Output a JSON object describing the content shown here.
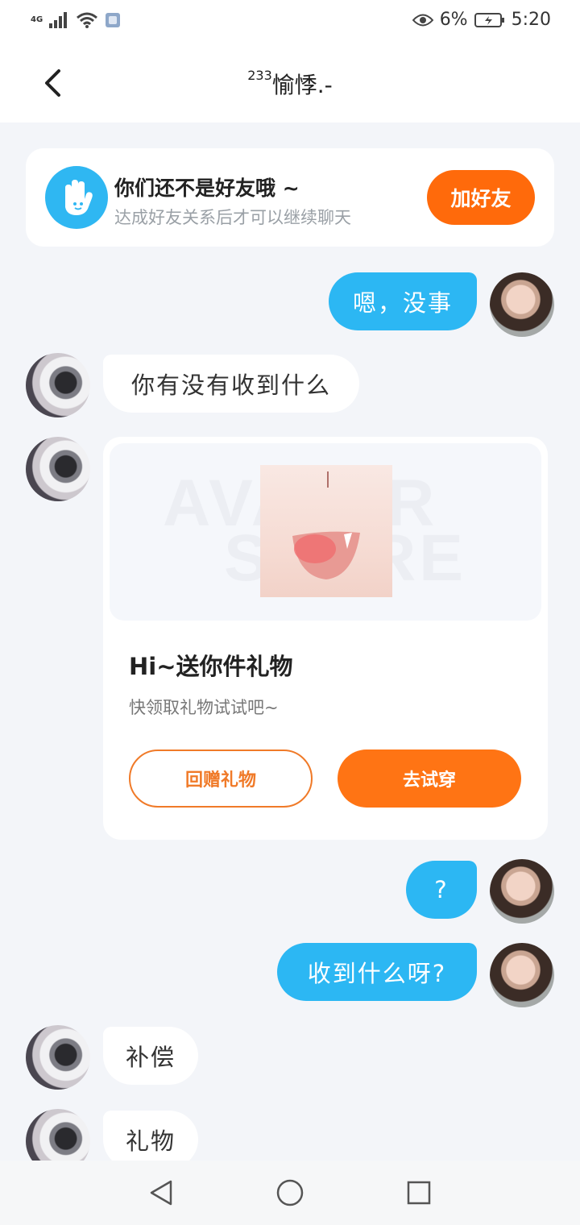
{
  "status_bar": {
    "network": "4G",
    "battery_percent": "6%",
    "time": "5:20",
    "icons": [
      "signal-icon",
      "wifi-icon",
      "app-notification-icon",
      "eye-icon",
      "battery-charging-icon"
    ]
  },
  "header": {
    "title_sup": "233",
    "title": "愉悸.-"
  },
  "friend_notice": {
    "title": "你们还不是好友哦 ~",
    "subtitle": "达成好友关系后才可以继续聊天",
    "button": "加好友",
    "icon": "hand-wave-icon"
  },
  "messages": {
    "m1": "嗯，没事",
    "m2": "你有没有收到什么",
    "m4": "?",
    "m5": "收到什么呀?",
    "m6": "补偿",
    "m7": "礼物"
  },
  "gift_card": {
    "watermark_1": "AVATAR",
    "watermark_2": "STORE",
    "title": "Hi~送你件礼物",
    "description": "快领取礼物试试吧~",
    "return_button": "回赠礼物",
    "try_button": "去试穿"
  },
  "colors": {
    "accent_blue": "#2cb7f3",
    "accent_orange": "#ff6a0b",
    "background": "#f3f5f9"
  }
}
